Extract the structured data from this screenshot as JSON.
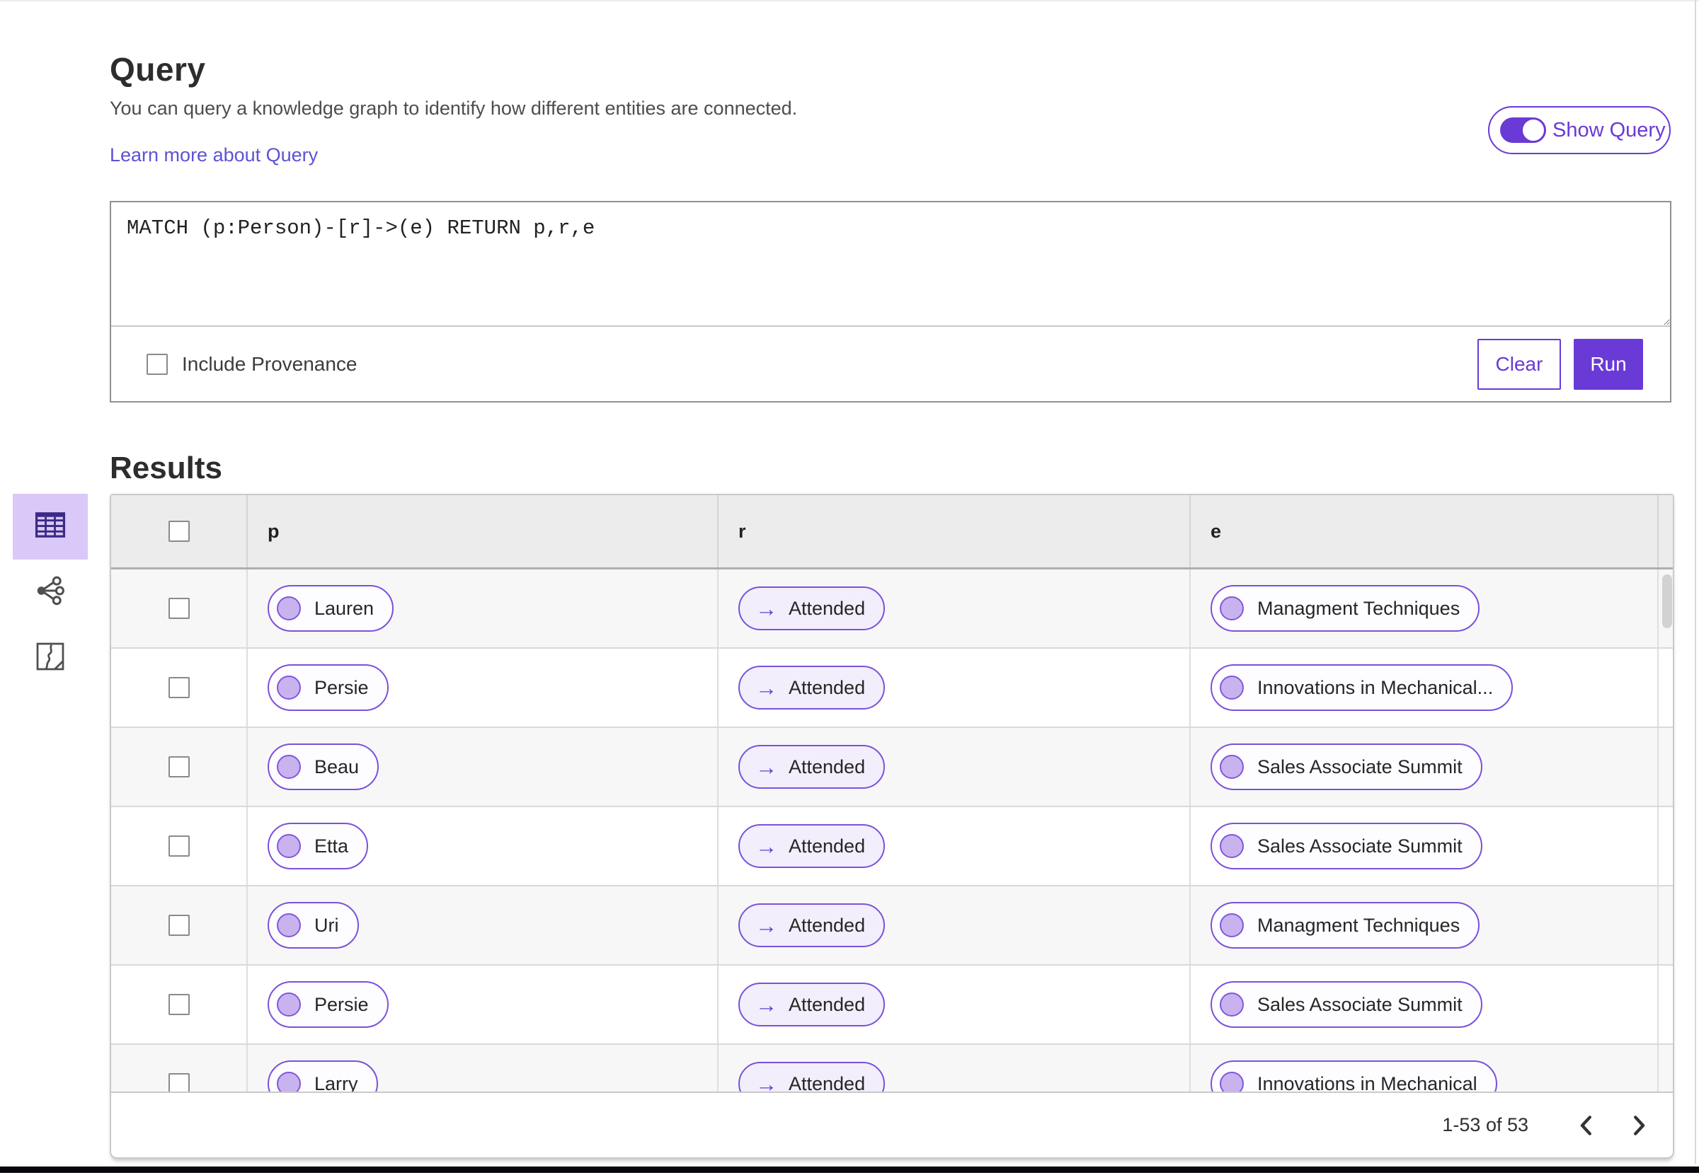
{
  "query_section": {
    "title": "Query",
    "description": "You can query a knowledge graph to identify how different entities are connected.",
    "learn_more_link": "Learn more about Query",
    "show_query_label": "Show Query",
    "show_query_on": true,
    "query_text": "MATCH (p:Person)-[r]->(e) RETURN p,r,e",
    "include_provenance_label": "Include Provenance",
    "include_provenance_checked": false,
    "clear_label": "Clear",
    "run_label": "Run"
  },
  "results_section": {
    "title": "Results",
    "view_switcher": [
      {
        "name": "table-view",
        "icon": "table-icon",
        "selected": true
      },
      {
        "name": "graph-view",
        "icon": "network-graph-icon",
        "selected": false
      },
      {
        "name": "map-view",
        "icon": "map-icon",
        "selected": false
      }
    ],
    "table": {
      "columns": [
        "p",
        "r",
        "e"
      ],
      "rows": [
        {
          "p": "Lauren",
          "r": "Attended",
          "e": "Managment Techniques"
        },
        {
          "p": "Persie",
          "r": "Attended",
          "e": "Innovations in Mechanical..."
        },
        {
          "p": "Beau",
          "r": "Attended",
          "e": "Sales Associate Summit"
        },
        {
          "p": "Etta",
          "r": "Attended",
          "e": "Sales Associate Summit"
        },
        {
          "p": "Uri",
          "r": "Attended",
          "e": "Managment Techniques"
        },
        {
          "p": "Persie",
          "r": "Attended",
          "e": "Sales Associate Summit"
        },
        {
          "p": "Larry",
          "r": "Attended",
          "e": "Innovations in Mechanical"
        }
      ]
    },
    "pagination": {
      "range_label": "1-53 of 53"
    }
  },
  "colors": {
    "accent_purple": "#6a3ad6",
    "pill_border": "#7b51dc",
    "pill_circle_fill": "#c9b3ef",
    "selected_view_bg": "#dac8f8",
    "link_purple": "#5d52d4",
    "table_header_bg": "#ececec",
    "row_alt_bg": "#f7f7f7"
  }
}
